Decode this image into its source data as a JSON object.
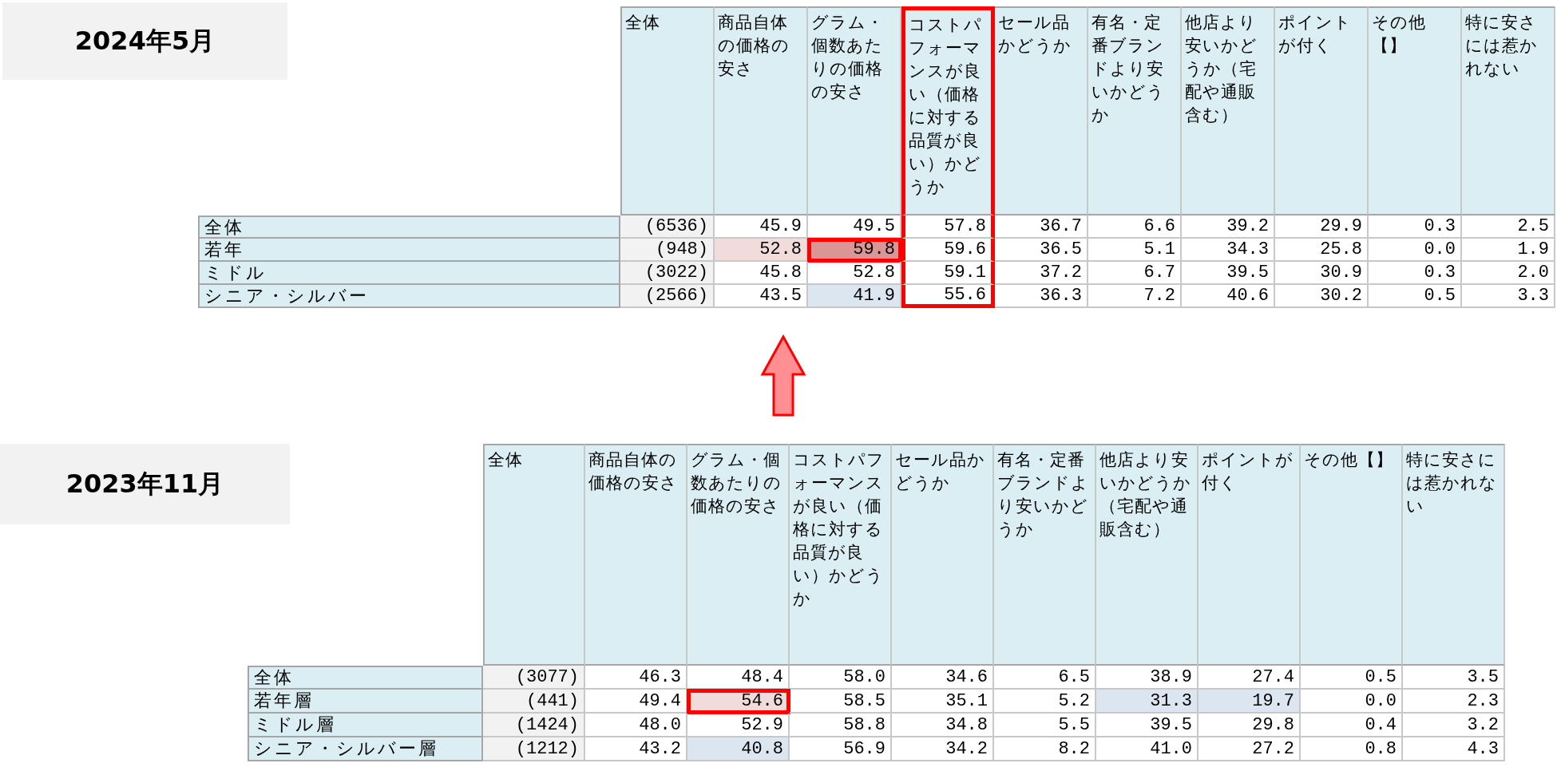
{
  "tables": [
    {
      "period": "2024年5月",
      "columns": [
        {
          "label": "全体",
          "boxed": false
        },
        {
          "label": "商品自体の価格の安さ",
          "boxed": false
        },
        {
          "label": "グラム・個数あたりの価格の安さ",
          "boxed": false
        },
        {
          "label": "コストパフォーマンスが良い（価格に対する品質が良い）かどうか",
          "boxed": true
        },
        {
          "label": "セール品かどうか",
          "boxed": false
        },
        {
          "label": "有名・定番ブランドより安いかどうか",
          "boxed": false
        },
        {
          "label": "他店より安いかどうか（宅配や通販含む）",
          "boxed": false
        },
        {
          "label": "ポイントが付く",
          "boxed": false
        },
        {
          "label": "その他【】",
          "boxed": false
        },
        {
          "label": "特に安さには惹かれない",
          "boxed": false
        }
      ],
      "rows": [
        {
          "label": "全体",
          "cells": [
            {
              "text": "(6536)",
              "boxed": false
            },
            {
              "text": "45.9",
              "boxed": false
            },
            {
              "text": "49.5",
              "boxed": false
            },
            {
              "text": "57.8",
              "boxed": false
            },
            {
              "text": "36.7",
              "boxed": false
            },
            {
              "text": "6.6",
              "boxed": false
            },
            {
              "text": "39.2",
              "boxed": false
            },
            {
              "text": "29.9",
              "boxed": false
            },
            {
              "text": "0.3",
              "boxed": false
            },
            {
              "text": "2.5",
              "boxed": false
            }
          ]
        },
        {
          "label": "若年",
          "cells": [
            {
              "text": "(948)",
              "boxed": false
            },
            {
              "text": "52.8",
              "color": "#f2dcdb",
              "boxed": false
            },
            {
              "text": "59.8",
              "color": "#da9694",
              "boxed": true
            },
            {
              "text": "59.6",
              "boxed": false
            },
            {
              "text": "36.5",
              "boxed": false
            },
            {
              "text": "5.1",
              "boxed": false
            },
            {
              "text": "34.3",
              "boxed": false
            },
            {
              "text": "25.8",
              "boxed": false
            },
            {
              "text": "0.0",
              "boxed": false
            },
            {
              "text": "1.9",
              "boxed": false
            }
          ]
        },
        {
          "label": "ミドル",
          "cells": [
            {
              "text": "(3022)",
              "boxed": false
            },
            {
              "text": "45.8",
              "boxed": false
            },
            {
              "text": "52.8",
              "boxed": false
            },
            {
              "text": "59.1",
              "boxed": false
            },
            {
              "text": "37.2",
              "boxed": false
            },
            {
              "text": "6.7",
              "boxed": false
            },
            {
              "text": "39.5",
              "boxed": false
            },
            {
              "text": "30.9",
              "boxed": false
            },
            {
              "text": "0.3",
              "boxed": false
            },
            {
              "text": "2.0",
              "boxed": false
            }
          ]
        },
        {
          "label": "シニア・シルバー",
          "cells": [
            {
              "text": "(2566)",
              "boxed": false
            },
            {
              "text": "43.5",
              "boxed": false
            },
            {
              "text": "41.9",
              "color": "#dce6f1",
              "boxed": false
            },
            {
              "text": "55.6",
              "boxed": false
            },
            {
              "text": "36.3",
              "boxed": false
            },
            {
              "text": "7.2",
              "boxed": false
            },
            {
              "text": "40.6",
              "boxed": false
            },
            {
              "text": "30.2",
              "boxed": false
            },
            {
              "text": "0.5",
              "boxed": false
            },
            {
              "text": "3.3",
              "boxed": false
            }
          ]
        }
      ]
    },
    {
      "period": "2023年11月",
      "columns": [
        {
          "label": "全体",
          "boxed": false
        },
        {
          "label": "商品自体の価格の安さ",
          "boxed": false
        },
        {
          "label": "グラム・個数あたりの価格の安さ",
          "boxed": false
        },
        {
          "label": "コストパフォーマンスが良い（価格に対する品質が良い）かどうか",
          "boxed": false
        },
        {
          "label": "セール品かどうか",
          "boxed": false
        },
        {
          "label": "有名・定番ブランドより安いかどうか",
          "boxed": false
        },
        {
          "label": "他店より安いかどうか（宅配や通販含む）",
          "boxed": false
        },
        {
          "label": "ポイントが付く",
          "boxed": false
        },
        {
          "label": "その他【】",
          "boxed": false
        },
        {
          "label": "特に安さには惹かれない",
          "boxed": false
        }
      ],
      "rows": [
        {
          "label": "全体",
          "cells": [
            {
              "text": "(3077)",
              "boxed": false
            },
            {
              "text": "46.3",
              "boxed": false
            },
            {
              "text": "48.4",
              "boxed": false
            },
            {
              "text": "58.0",
              "boxed": false
            },
            {
              "text": "34.6",
              "boxed": false
            },
            {
              "text": "6.5",
              "boxed": false
            },
            {
              "text": "38.9",
              "boxed": false
            },
            {
              "text": "27.4",
              "boxed": false
            },
            {
              "text": "0.5",
              "boxed": false
            },
            {
              "text": "3.5",
              "boxed": false
            }
          ]
        },
        {
          "label": "若年層",
          "cells": [
            {
              "text": "(441)",
              "boxed": false
            },
            {
              "text": "49.4",
              "boxed": false
            },
            {
              "text": "54.6",
              "color": "#f2dcdb",
              "boxed": true
            },
            {
              "text": "58.5",
              "boxed": false
            },
            {
              "text": "35.1",
              "boxed": false
            },
            {
              "text": "5.2",
              "boxed": false
            },
            {
              "text": "31.3",
              "color": "#dce6f1",
              "boxed": false
            },
            {
              "text": "19.7",
              "color": "#dce6f1",
              "boxed": false
            },
            {
              "text": "0.0",
              "boxed": false
            },
            {
              "text": "2.3",
              "boxed": false
            }
          ]
        },
        {
          "label": "ミドル層",
          "cells": [
            {
              "text": "(1424)",
              "boxed": false
            },
            {
              "text": "48.0",
              "boxed": false
            },
            {
              "text": "52.9",
              "boxed": false
            },
            {
              "text": "58.8",
              "boxed": false
            },
            {
              "text": "34.8",
              "boxed": false
            },
            {
              "text": "5.5",
              "boxed": false
            },
            {
              "text": "39.5",
              "boxed": false
            },
            {
              "text": "29.8",
              "boxed": false
            },
            {
              "text": "0.4",
              "boxed": false
            },
            {
              "text": "3.2",
              "boxed": false
            }
          ]
        },
        {
          "label": "シニア・シルバー層",
          "cells": [
            {
              "text": "(1212)",
              "boxed": false
            },
            {
              "text": "43.2",
              "boxed": false
            },
            {
              "text": "40.8",
              "color": "#dce6f1",
              "boxed": false
            },
            {
              "text": "56.9",
              "boxed": false
            },
            {
              "text": "34.2",
              "boxed": false
            },
            {
              "text": "8.2",
              "boxed": false
            },
            {
              "text": "41.0",
              "boxed": false
            },
            {
              "text": "27.2",
              "boxed": false
            },
            {
              "text": "0.8",
              "boxed": false
            },
            {
              "text": "4.3",
              "boxed": false
            }
          ]
        }
      ]
    }
  ]
}
